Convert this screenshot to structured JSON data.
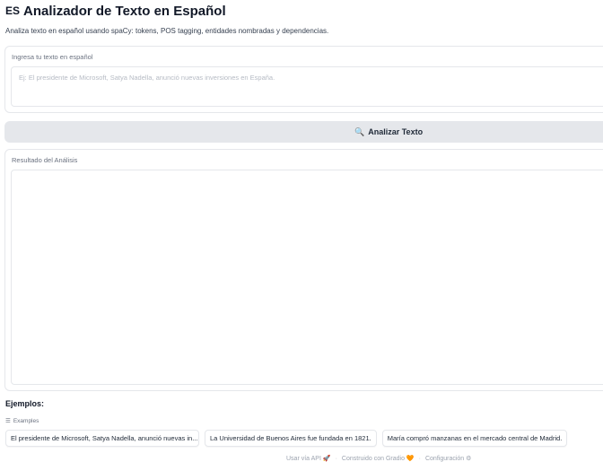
{
  "header": {
    "flag_text": "ES",
    "title": "Analizador de Texto en Español",
    "subtitle": "Analiza texto en español usando spaCy: tokens, POS tagging, entidades nombradas y dependencias."
  },
  "input": {
    "label": "Ingresa tu texto en español",
    "placeholder": "Ej: El presidente de Microsoft, Satya Nadella, anunció nuevas inversiones en España."
  },
  "analyze_button": {
    "icon": "🔍",
    "label": "Analizar Texto"
  },
  "output": {
    "label": "Resultado del Análisis"
  },
  "examples": {
    "heading": "Ejemplos:",
    "tag_icon": "☰",
    "tag_label": "Examples",
    "items": [
      "El presidente de Microsoft, Satya Nadella, anunció nuevas in...",
      "La Universidad de Buenos Aires fue fundada en 1821.",
      "María compró manzanas en el mercado central de Madrid."
    ]
  },
  "footer": {
    "api_label": "Usar vía API",
    "api_icon": "🚀",
    "gradio_label": "Construido con Gradio",
    "gradio_icon": "🧡",
    "settings_label": "Configuración",
    "settings_icon": "⚙",
    "separator": "·"
  }
}
